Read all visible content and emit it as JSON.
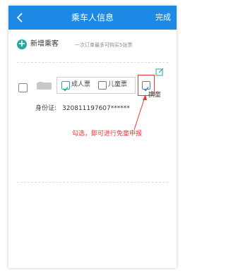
{
  "navbar": {
    "title": "乘车人信息",
    "done_label": "完成",
    "bg_color": "#1e88e5"
  },
  "add_passenger": {
    "label": "新增乘客",
    "hint": "一次订单最多可购买5张票",
    "icon": "plus-circle-icon",
    "icon_color": "#26a9a0"
  },
  "passenger": {
    "selected": false,
    "ticket_types": [
      {
        "label": "成人票",
        "checked": true
      },
      {
        "label": "儿童票",
        "checked": false
      }
    ],
    "carry_child": {
      "label": "携童",
      "checked": true
    },
    "id_label": "身份证:",
    "id_value": "320811197607******"
  },
  "annotation": {
    "text": "勾选，即可进行免童申报",
    "color": "#e53935"
  }
}
